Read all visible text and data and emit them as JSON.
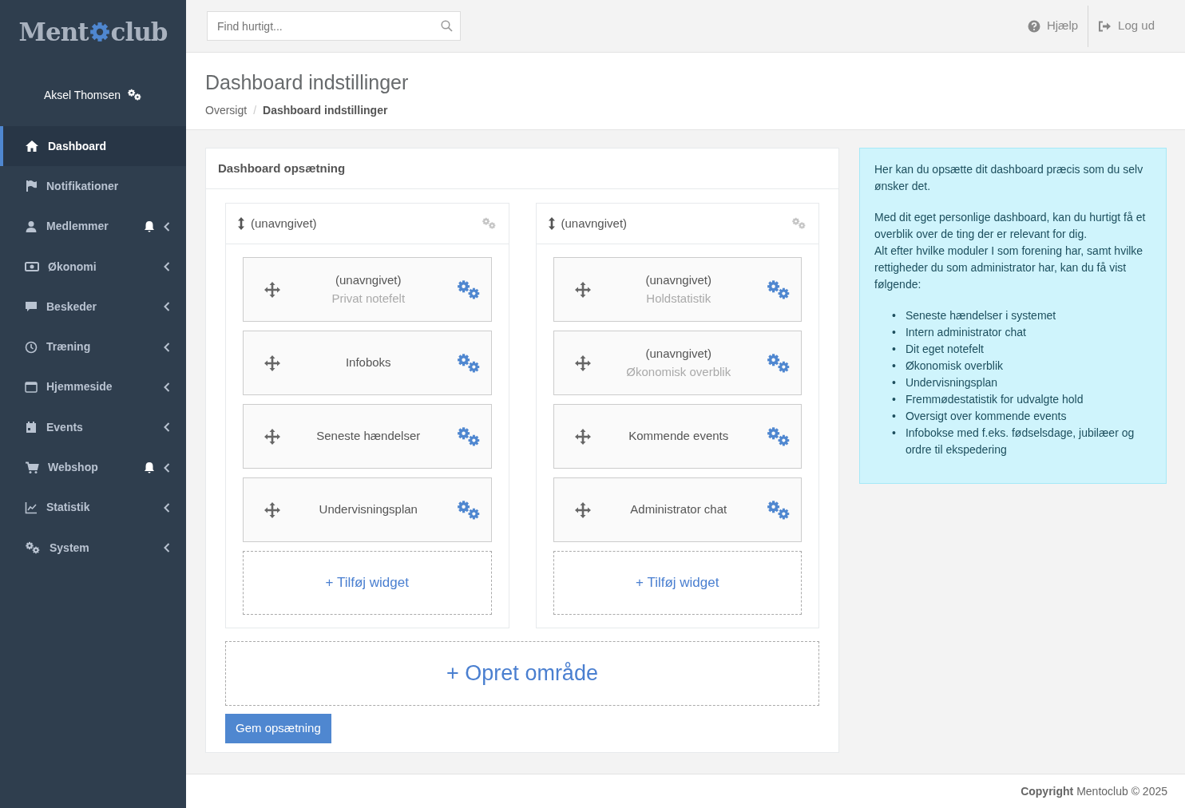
{
  "logo": {
    "before": "Ment",
    "after": "club"
  },
  "user": {
    "name": "Aksel Thomsen"
  },
  "sidebar": {
    "items": [
      {
        "label": "Dashboard",
        "kind": "home",
        "selected": true,
        "bell": false,
        "chevron": false
      },
      {
        "label": "Notifikationer",
        "kind": "flag",
        "selected": false,
        "bell": false,
        "chevron": false
      },
      {
        "label": "Medlemmer",
        "kind": "user",
        "selected": false,
        "bell": true,
        "chevron": true
      },
      {
        "label": "Økonomi",
        "kind": "money",
        "selected": false,
        "bell": false,
        "chevron": true
      },
      {
        "label": "Beskeder",
        "kind": "chat",
        "selected": false,
        "bell": false,
        "chevron": true
      },
      {
        "label": "Træning",
        "kind": "clock",
        "selected": false,
        "bell": false,
        "chevron": true
      },
      {
        "label": "Hjemmeside",
        "kind": "window",
        "selected": false,
        "bell": false,
        "chevron": true
      },
      {
        "label": "Events",
        "kind": "calendar",
        "selected": false,
        "bell": false,
        "chevron": true
      },
      {
        "label": "Webshop",
        "kind": "cart",
        "selected": false,
        "bell": true,
        "chevron": true
      },
      {
        "label": "Statistik",
        "kind": "chart",
        "selected": false,
        "bell": false,
        "chevron": true
      },
      {
        "label": "System",
        "kind": "gears",
        "selected": false,
        "bell": false,
        "chevron": true
      }
    ]
  },
  "topbar": {
    "search": {
      "placeholder": "Find hurtigt..."
    },
    "links": [
      {
        "label": "Hjælp",
        "kind": "help"
      },
      {
        "label": "Log ud",
        "kind": "logout"
      }
    ]
  },
  "header": {
    "title": "Dashboard indstillinger",
    "separator": "/",
    "breadcrumb": [
      {
        "label": "Oversigt",
        "selected": false
      },
      {
        "label": "Dashboard indstillinger",
        "selected": true
      }
    ]
  },
  "setup": {
    "title": "Dashboard opsætning",
    "areas": [
      {
        "title": "(unavngivet)",
        "widgets": [
          {
            "title": "(unavngivet)",
            "subtitle": "Privat notefelt"
          },
          {
            "title": "Infoboks"
          },
          {
            "title": "Seneste hændelser"
          },
          {
            "title": "Undervisningsplan"
          }
        ],
        "add_label": "+ Tilføj widget"
      },
      {
        "title": "(unavngivet)",
        "widgets": [
          {
            "title": "(unavngivet)",
            "subtitle": "Holdstatistik"
          },
          {
            "title": "(unavngivet)",
            "subtitle": "Økonomisk overblik"
          },
          {
            "title": "Kommende events"
          },
          {
            "title": "Administrator chat"
          }
        ],
        "add_label": "+ Tilføj widget"
      }
    ],
    "create_area": "+ Opret område",
    "save": "Gem opsætning"
  },
  "info": {
    "paragraphs": [
      "Her kan du opsætte dit dashboard præcis som du selv ønsker det.",
      "Med dit eget personlige dashboard, kan du hurtigt få et overblik over de ting der er relevant for dig.\nAlt efter hvilke moduler I som forening har, samt hvilke rettigheder du som administrator har, kan du få vist følgende:"
    ],
    "list": [
      {
        "bullet": "•",
        "text": "Seneste hændelser i systemet"
      },
      {
        "bullet": "•",
        "text": "Intern administrator chat"
      },
      {
        "bullet": "•",
        "text": "Dit eget notefelt"
      },
      {
        "bullet": "•",
        "text": "Økonomisk overblik"
      },
      {
        "bullet": "•",
        "text": "Undervisningsplan"
      },
      {
        "bullet": "•",
        "text": "Fremmødestatistik for udvalgte hold"
      },
      {
        "bullet": "•",
        "text": "Oversigt over kommende events"
      },
      {
        "bullet": "•",
        "text": "Infobokse med f.eks. fødselsdage, jubilæer og ordre til ekspedering"
      }
    ]
  },
  "footer": {
    "bold": "Copyright",
    "text": "Mentoclub © 2025"
  }
}
